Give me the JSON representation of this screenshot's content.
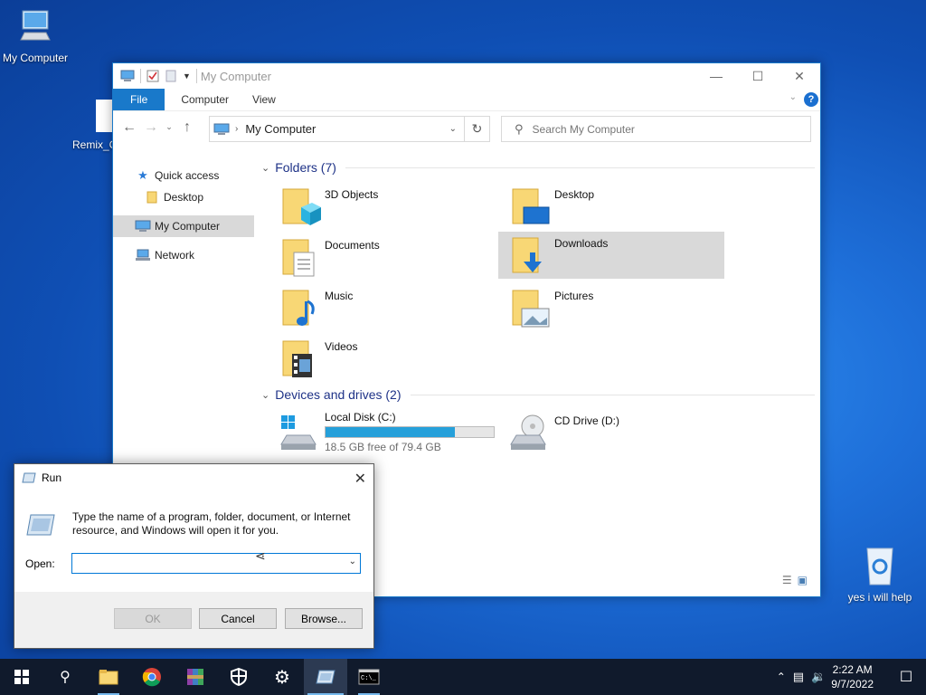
{
  "desktop": {
    "icons": [
      {
        "label": "My Computer"
      },
      {
        "label": "Remix_C"
      },
      {
        "label": "yes i will help"
      }
    ]
  },
  "explorer": {
    "title": "My Computer",
    "ribbon_tabs": [
      "File",
      "Computer",
      "View"
    ],
    "address": "My Computer",
    "search_placeholder": "Search My Computer",
    "nav": {
      "quick_access": "Quick access",
      "desktop": "Desktop",
      "my_computer": "My Computer",
      "network": "Network"
    },
    "folders_header": "Folders (7)",
    "folders": [
      "3D Objects",
      "Desktop",
      "Documents",
      "Downloads",
      "Music",
      "Pictures",
      "Videos"
    ],
    "drives_header": "Devices and drives (2)",
    "drives": [
      {
        "name": "Local Disk (C:)",
        "free": "18.5 GB free of 79.4 GB",
        "used_fraction": 0.767
      },
      {
        "name": "CD Drive (D:)"
      }
    ]
  },
  "run_dialog": {
    "title": "Run",
    "description": "Type the name of a program, folder, document, or Internet resource, and Windows will open it for you.",
    "open_label": "Open:",
    "open_value": "",
    "ok": "OK",
    "cancel": "Cancel",
    "browse": "Browse..."
  },
  "taskbar": {
    "time": "2:22 AM",
    "date": "9/7/2022"
  },
  "colors": {
    "accent": "#1979ca",
    "selection": "#d9d9d9",
    "progress": "#26a0da",
    "taskbar": "#101a2c"
  }
}
